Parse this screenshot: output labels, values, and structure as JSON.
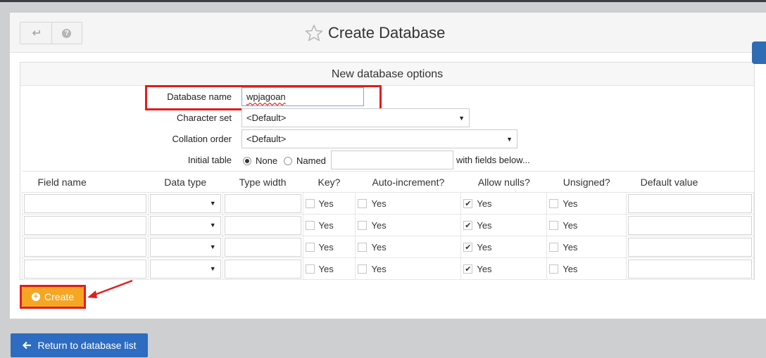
{
  "header": {
    "title": "Create Database",
    "back_icon": "back-arrow-icon",
    "help_icon": "help-icon",
    "help_glyph": "?"
  },
  "options": {
    "section_title": "New database options",
    "db_name_label": "Database name",
    "db_name_value": "wpjagoan",
    "charset_label": "Character set",
    "charset_value": "<Default>",
    "collation_label": "Collation order",
    "collation_value": "<Default>",
    "initial_table_label": "Initial table",
    "radio_none": "None",
    "radio_named": "Named",
    "named_value": "",
    "fields_below": "with fields below..."
  },
  "fields_table": {
    "columns": [
      "Field name",
      "Data type",
      "Type width",
      "Key?",
      "Auto-increment?",
      "Allow nulls?",
      "Unsigned?",
      "Default value"
    ],
    "yes_label": "Yes",
    "rows": [
      {
        "key": false,
        "auto": false,
        "nulls": true,
        "unsigned": false
      },
      {
        "key": false,
        "auto": false,
        "nulls": true,
        "unsigned": false
      },
      {
        "key": false,
        "auto": false,
        "nulls": true,
        "unsigned": false
      },
      {
        "key": false,
        "auto": false,
        "nulls": true,
        "unsigned": false
      }
    ]
  },
  "actions": {
    "create_label": "Create",
    "return_label": "Return to database list"
  },
  "colors": {
    "create": "#f5a623",
    "return": "#2d6cc0",
    "highlight": "#e31c1c"
  }
}
